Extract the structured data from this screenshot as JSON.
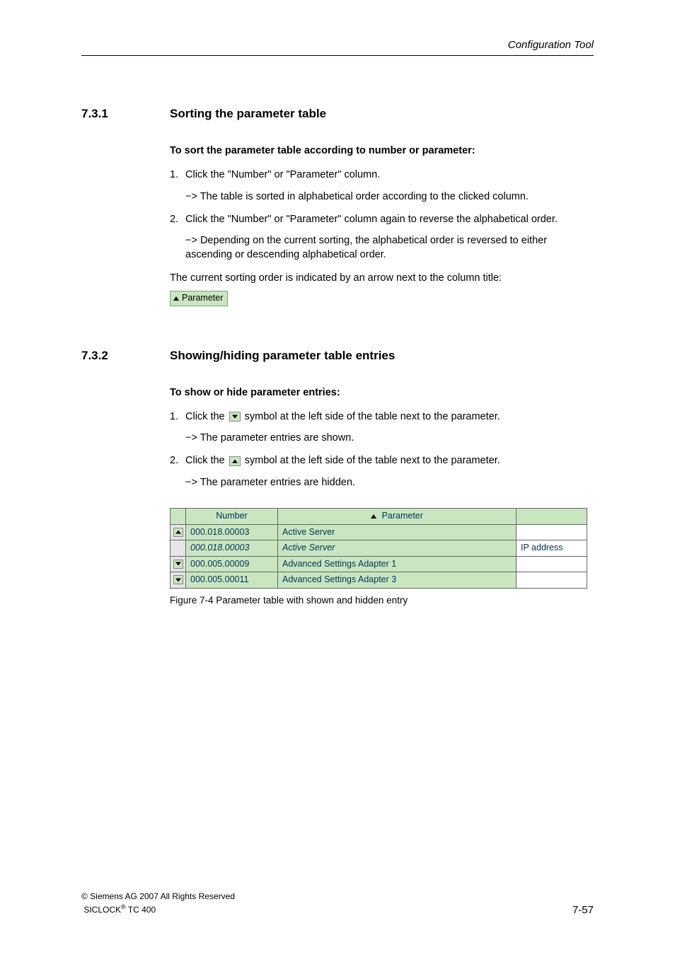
{
  "header": {
    "right": "Configuration Tool"
  },
  "s1": {
    "num": "7.3.1",
    "title": "Sorting the parameter table",
    "subhead": "To sort the parameter table according to number or parameter:",
    "step1": "Click the \"Number\" or \"Parameter\" column.",
    "res1": "−> The table is sorted in alphabetical order according to the clicked column.",
    "step2": "Click the \"Number\" or \"Parameter\" column again to reverse the alphabetical order.",
    "res2": "−> Depending on the current sorting, the alphabetical order is reversed to either ascending or descending alphabetical order.",
    "para": "The current sorting order is indicated by an arrow next to the column title:",
    "indicator_label": "Parameter"
  },
  "s2": {
    "num": "7.3.2",
    "title": "Showing/hiding parameter table entries",
    "subhead": "To show or hide parameter entries:",
    "step1a": "Click the ",
    "step1b": " symbol at the left side of the table next to the parameter.",
    "res1": "−> The parameter entries are shown.",
    "step2a": "Click the ",
    "step2b": " symbol at the left side of the table next to the parameter.",
    "res2": "−> The parameter entries are hidden."
  },
  "table": {
    "h_number": "Number",
    "h_parameter": "Parameter",
    "rows": [
      {
        "btn": "up",
        "num": "000.018.00003",
        "par": "Active Server",
        "val": ""
      },
      {
        "btn": "",
        "num": "000.018.00003",
        "par": "Active Server",
        "val": "IP address",
        "expanded": true
      },
      {
        "btn": "down",
        "num": "000.005.00009",
        "par": "Advanced Settings Adapter 1",
        "val": ""
      },
      {
        "btn": "down",
        "num": "000.005.00011",
        "par": "Advanced Settings Adapter 3",
        "val": ""
      }
    ],
    "caption": "Figure 7-4 Parameter table with shown and hidden entry"
  },
  "footer": {
    "copyright": "© Siemens AG 2007 All Rights Reserved",
    "product_a": "SICLOCK",
    "product_reg": "®",
    "product_b": " TC 400",
    "page": "7-57"
  }
}
